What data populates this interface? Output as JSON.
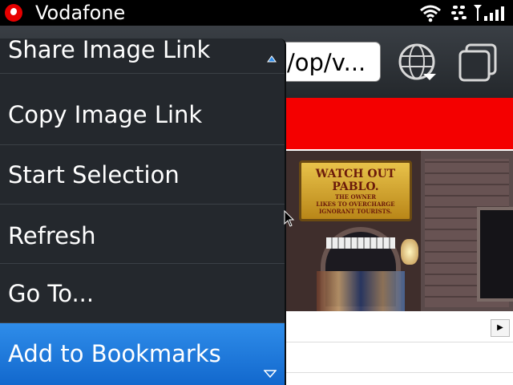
{
  "status_bar": {
    "carrier": "Vodafone",
    "icons": [
      "wifi-icon",
      "blackberry-icon",
      "signal-icon"
    ]
  },
  "toolbar": {
    "url_text": "/op/v...",
    "icons": [
      "globe-icon",
      "tabs-icon"
    ]
  },
  "context_menu": {
    "items": [
      {
        "label": "Share Image Link",
        "selected": false
      },
      {
        "label": "Copy Image Link",
        "selected": false
      },
      {
        "label": "Start Selection",
        "selected": false
      },
      {
        "label": "Refresh",
        "selected": false
      },
      {
        "label": "Go To...",
        "selected": false
      },
      {
        "label": "Add to Bookmarks",
        "selected": true
      }
    ]
  },
  "page_image": {
    "sign_title": "WATCH OUT PABLO.",
    "sign_line_1": "THE OWNER",
    "sign_line_2": "LIKES TO OVERCHARGE",
    "sign_line_3": "IGNORANT TOURISTS."
  },
  "colors": {
    "menu_bg": "#24282d",
    "selection": "#1f7be0",
    "banner": "#f40000"
  }
}
